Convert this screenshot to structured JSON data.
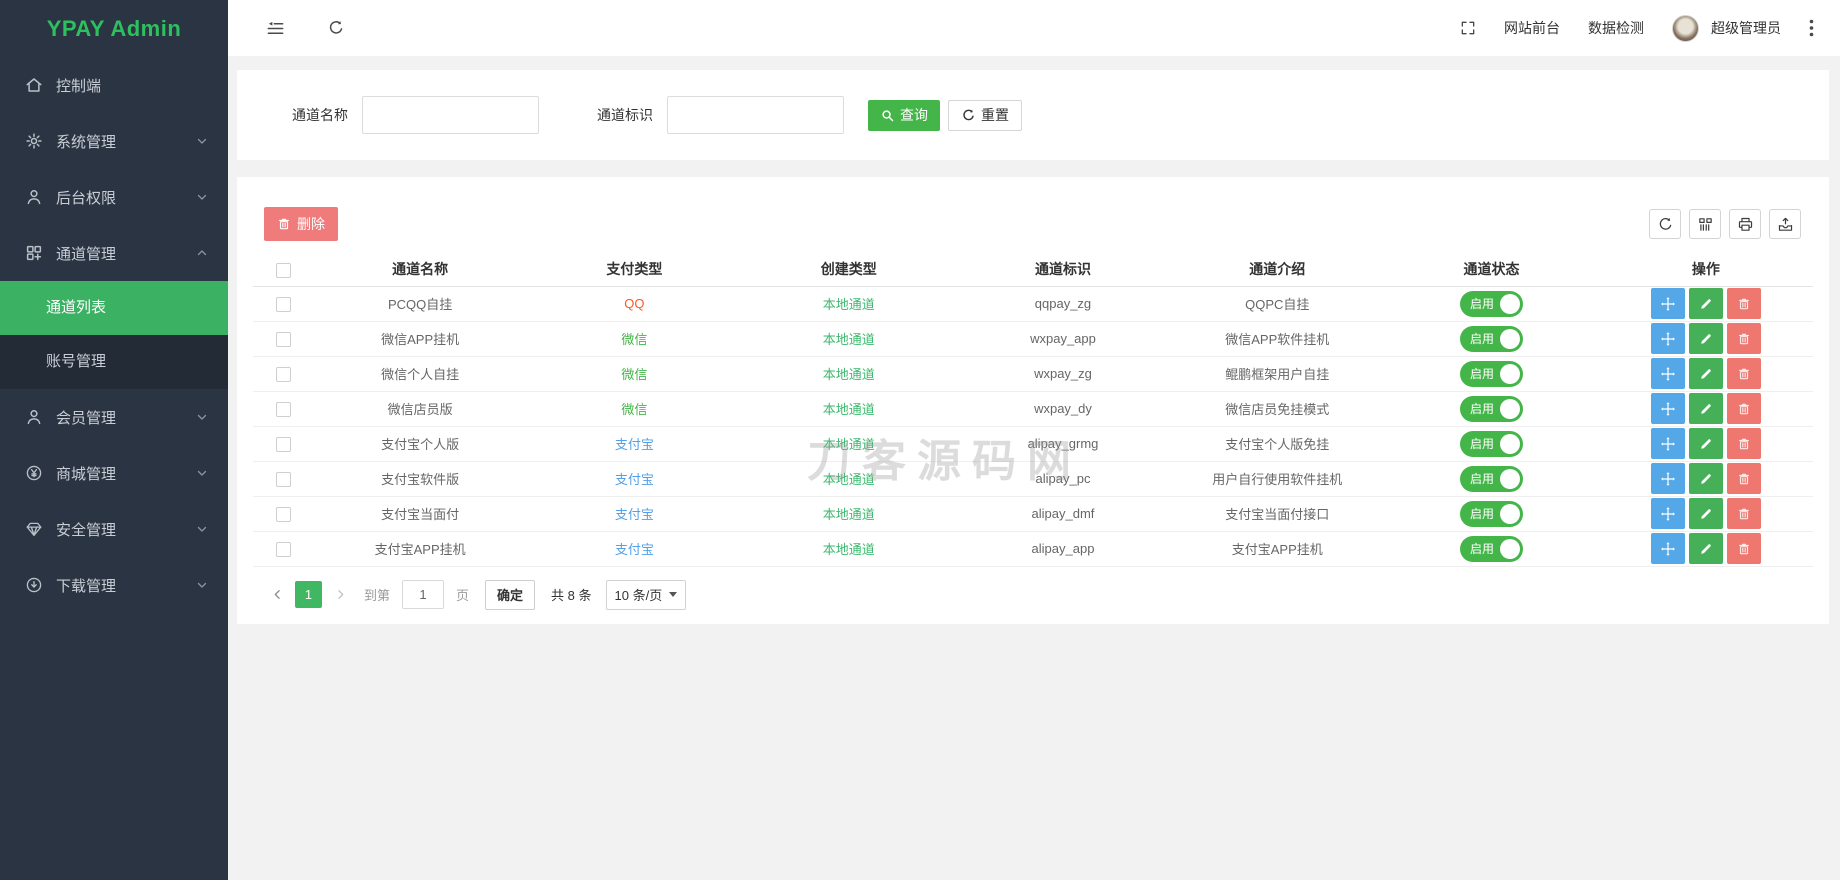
{
  "app": {
    "title": "YPAY Admin"
  },
  "topbar": {
    "front_link": "网站前台",
    "monitor_link": "数据检测",
    "username": "超级管理员"
  },
  "sidebar": {
    "items": [
      {
        "key": "dashboard",
        "label": "控制端",
        "icon": "home-icon"
      },
      {
        "key": "system",
        "label": "系统管理",
        "icon": "gear-icon",
        "caret": "down"
      },
      {
        "key": "admin-auth",
        "label": "后台权限",
        "icon": "user-icon",
        "caret": "down"
      },
      {
        "key": "channel",
        "label": "通道管理",
        "icon": "channels-icon",
        "caret": "up",
        "children": [
          {
            "key": "channel-list",
            "label": "通道列表",
            "active": true
          },
          {
            "key": "account-manage",
            "label": "账号管理",
            "active": false
          }
        ]
      },
      {
        "key": "members",
        "label": "会员管理",
        "icon": "user-icon",
        "caret": "down"
      },
      {
        "key": "mall",
        "label": "商城管理",
        "icon": "yen-icon",
        "caret": "down"
      },
      {
        "key": "security",
        "label": "安全管理",
        "icon": "shield-icon",
        "caret": "down"
      },
      {
        "key": "download",
        "label": "下载管理",
        "icon": "download-icon",
        "caret": "down"
      }
    ]
  },
  "search": {
    "name_label": "通道名称",
    "name_value": "",
    "code_label": "通道标识",
    "code_value": "",
    "query_label": "查询",
    "reset_label": "重置"
  },
  "toolbar": {
    "delete_label": "删除"
  },
  "colors": {
    "qq": "#ff5722",
    "wechat": "#44b549",
    "alipay": "#54a0e8",
    "local_channel": "#3cb96e",
    "accent_green": "#44b549",
    "sidebar_active": "#3bb163",
    "action_blue": "#54a8e8",
    "action_green": "#45b058",
    "action_red": "#ee7770",
    "delete_red": "#f07b7b"
  },
  "table": {
    "headers": [
      "通道名称",
      "支付类型",
      "创建类型",
      "通道标识",
      "通道介绍",
      "通道状态",
      "操作"
    ],
    "status_on_label": "启用",
    "rows": [
      {
        "name": "PCQQ自挂",
        "pay_type": "QQ",
        "pay_type_key": "qq",
        "create_type": "本地通道",
        "code": "qqpay_zg",
        "desc": "QQPC自挂",
        "status": "启用"
      },
      {
        "name": "微信APP挂机",
        "pay_type": "微信",
        "pay_type_key": "wechat",
        "create_type": "本地通道",
        "code": "wxpay_app",
        "desc": "微信APP软件挂机",
        "status": "启用"
      },
      {
        "name": "微信个人自挂",
        "pay_type": "微信",
        "pay_type_key": "wechat",
        "create_type": "本地通道",
        "code": "wxpay_zg",
        "desc": "鲲鹏框架用户自挂",
        "status": "启用"
      },
      {
        "name": "微信店员版",
        "pay_type": "微信",
        "pay_type_key": "wechat",
        "create_type": "本地通道",
        "code": "wxpay_dy",
        "desc": "微信店员免挂模式",
        "status": "启用"
      },
      {
        "name": "支付宝个人版",
        "pay_type": "支付宝",
        "pay_type_key": "alipay",
        "create_type": "本地通道",
        "code": "alipay_grmg",
        "desc": "支付宝个人版免挂",
        "status": "启用"
      },
      {
        "name": "支付宝软件版",
        "pay_type": "支付宝",
        "pay_type_key": "alipay",
        "create_type": "本地通道",
        "code": "alipay_pc",
        "desc": "用户自行使用软件挂机",
        "status": "启用"
      },
      {
        "name": "支付宝当面付",
        "pay_type": "支付宝",
        "pay_type_key": "alipay",
        "create_type": "本地通道",
        "code": "alipay_dmf",
        "desc": "支付宝当面付接口",
        "status": "启用"
      },
      {
        "name": "支付宝APP挂机",
        "pay_type": "支付宝",
        "pay_type_key": "alipay",
        "create_type": "本地通道",
        "code": "alipay_app",
        "desc": "支付宝APP挂机",
        "status": "启用"
      }
    ]
  },
  "pagination": {
    "active_page": "1",
    "goto_prefix": "到第",
    "goto_value": "1",
    "goto_suffix": "页",
    "confirm_label": "确定",
    "total_text": "共 8 条",
    "page_size": "10 条/页"
  },
  "watermark": "刀客源码网"
}
